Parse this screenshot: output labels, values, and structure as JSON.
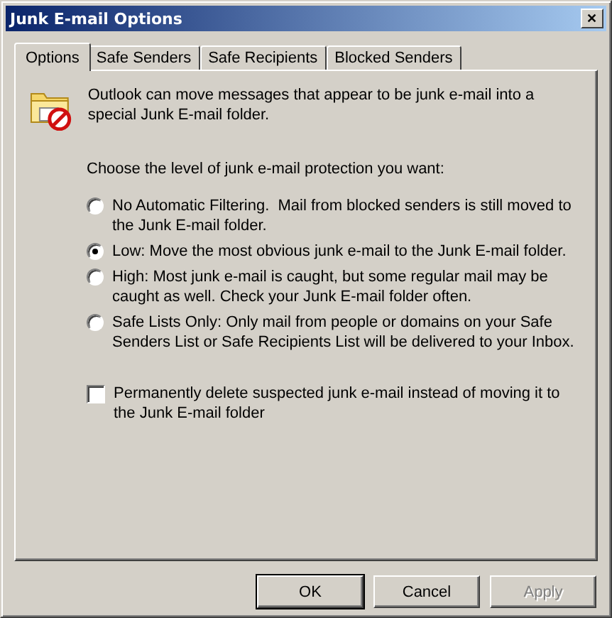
{
  "window": {
    "title": "Junk E-mail Options",
    "close": "✕"
  },
  "tabs": [
    {
      "label": "Options",
      "selected": true
    },
    {
      "label": "Safe Senders",
      "selected": false
    },
    {
      "label": "Safe Recipients",
      "selected": false
    },
    {
      "label": "Blocked Senders",
      "selected": false
    }
  ],
  "intro": "Outlook can move messages that appear to be junk e-mail into a special Junk E-mail folder.",
  "prompt": "Choose the level of junk e-mail protection you want:",
  "levels": [
    {
      "label": "No Automatic Filtering.  Mail from blocked senders is still moved to the Junk E-mail folder.",
      "selected": false
    },
    {
      "label": "Low: Move the most obvious junk e-mail to the Junk E-mail folder.",
      "selected": true
    },
    {
      "label": "High: Most junk e-mail is caught, but some regular mail may be caught as well. Check your Junk E-mail folder often.",
      "selected": false
    },
    {
      "label": "Safe Lists Only: Only mail from people or domains on your Safe Senders List or Safe Recipients List will be delivered to your Inbox.",
      "selected": false
    }
  ],
  "delete_option": {
    "label": "Permanently delete suspected junk e-mail instead of moving it to the Junk E-mail folder",
    "checked": false
  },
  "buttons": [
    {
      "label": "OK",
      "disabled": false,
      "default": true
    },
    {
      "label": "Cancel",
      "disabled": false,
      "default": false
    },
    {
      "label": "Apply",
      "disabled": true,
      "default": false
    }
  ]
}
